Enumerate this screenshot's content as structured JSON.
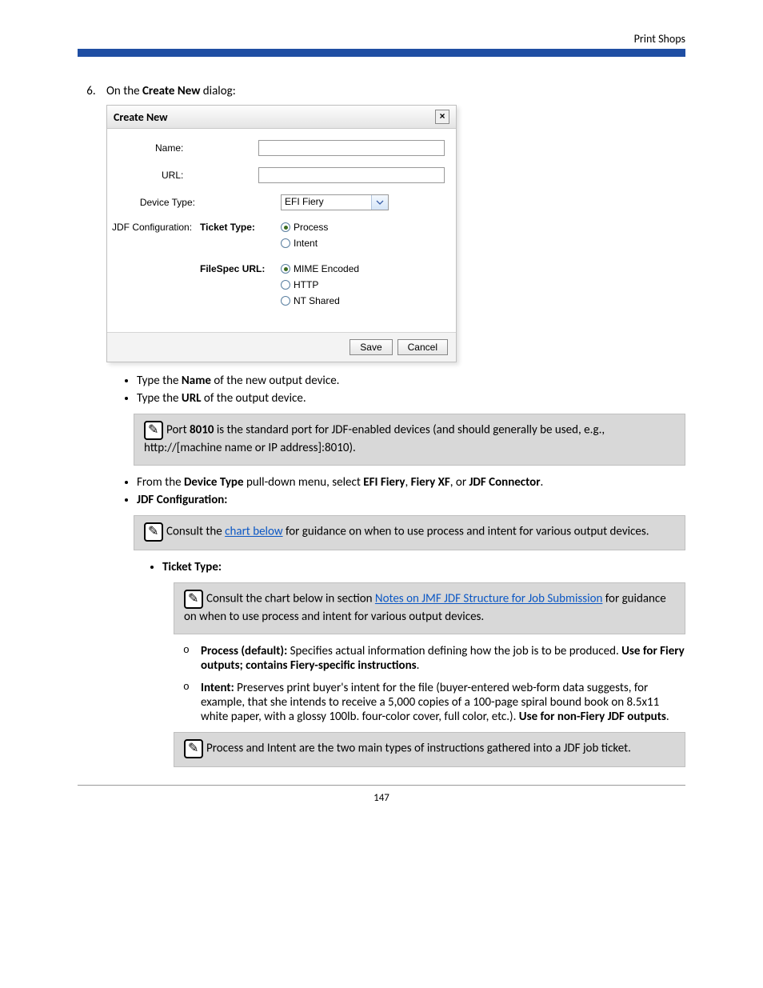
{
  "header": {
    "right": "Print Shops"
  },
  "step": {
    "number": "6.",
    "intro_prefix": "On the ",
    "intro_bold": "Create New",
    "intro_suffix": " dialog:"
  },
  "dialog": {
    "title": "Create New",
    "labels": {
      "name": "Name:",
      "url": "URL:",
      "device_type": "Device Type:",
      "jdf_config": "JDF Configuration:",
      "ticket_type": "Ticket Type:",
      "filespec_url": "FileSpec URL:"
    },
    "device_type_value": "EFI Fiery",
    "ticket_options": [
      "Process",
      "Intent"
    ],
    "filespec_options": [
      "MIME Encoded",
      "HTTP",
      "NT Shared"
    ],
    "save": "Save",
    "cancel": "Cancel"
  },
  "content": {
    "b1_pre": "Type the ",
    "b1_bold": "Name",
    "b1_post": " of the new output device.",
    "b2_pre": "Type the ",
    "b2_bold": "URL",
    "b2_post": " of the output device.",
    "note1_a": "Port ",
    "note1_port": "8010",
    "note1_b": " is the standard port for JDF-enabled devices (and should generally be used, e.g., http://[machine name or IP address]:8010).",
    "b3_pre": "From the ",
    "b3_bold1": "Device Type",
    "b3_mid": " pull-down menu, select ",
    "b3_bold2": "EFI Fiery",
    "b3_sep2": ", ",
    "b3_bold3": "Fiery XF",
    "b3_sep3": ", or ",
    "b3_bold4": "JDF Connector",
    "b3_end": ".",
    "b4": "JDF Configuration:",
    "note2_a": "Consult the ",
    "note2_link": "chart below",
    "note2_b": " for guidance on when to use process and intent for various output devices.",
    "sub1": "Ticket Type:",
    "note3_a": "Consult the chart below in section ",
    "note3_link": "Notes on JMF JDF Structure for Job Submission",
    "note3_b": " for guidance on when to use process and intent for various output devices.",
    "o1_bold": "Process (default):",
    "o1_text": " Specifies actual information defining how the job is to be produced. ",
    "o1_bold2": "Use for Fiery outputs; contains Fiery-specific instructions",
    "o1_end": ".",
    "o2_bold": "Intent:",
    "o2_text": " Preserves print buyer's intent for the file (buyer-entered web-form data suggests, for example, that she intends to receive a 5,000 copies of a 100-page spiral bound book on 8.5x11 white paper, with a glossy 100lb. four-color cover, full color, etc.). ",
    "o2_bold2": "Use for non-Fiery JDF outputs",
    "o2_end": ".",
    "note4": "Process and Intent are the two main types of instructions gathered into a JDF job ticket."
  },
  "page_number": "147"
}
